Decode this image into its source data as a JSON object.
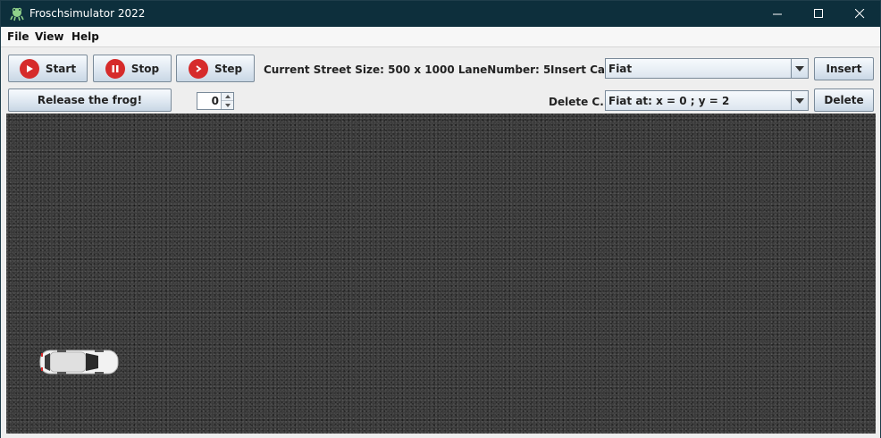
{
  "window": {
    "title": "Froschsimulator 2022"
  },
  "menu": {
    "items": [
      "File",
      "View",
      "Help"
    ]
  },
  "toolbar": {
    "start_label": "Start",
    "stop_label": "Stop",
    "step_label": "Step",
    "release_label": "Release the frog!",
    "spinner_value": "0",
    "street_size_text": "Current Street Size: 500 x 1000 LaneNumber: 5",
    "insert_car_label": "Insert Car",
    "insert_car_selected": "Fiat",
    "insert_button": "Insert",
    "delete_car_label": "Delete C...",
    "delete_car_selected": "Fiat at: x = 0 ; y = 2",
    "delete_button": "Delete"
  },
  "icons": {
    "start": "play-icon",
    "stop": "pause-icon",
    "step": "step-forward-icon",
    "app": "frog-app-icon"
  },
  "colors": {
    "titlebar": "#0d2f3c",
    "accent_red": "#d62b2b",
    "street": "#3a3a3a"
  }
}
